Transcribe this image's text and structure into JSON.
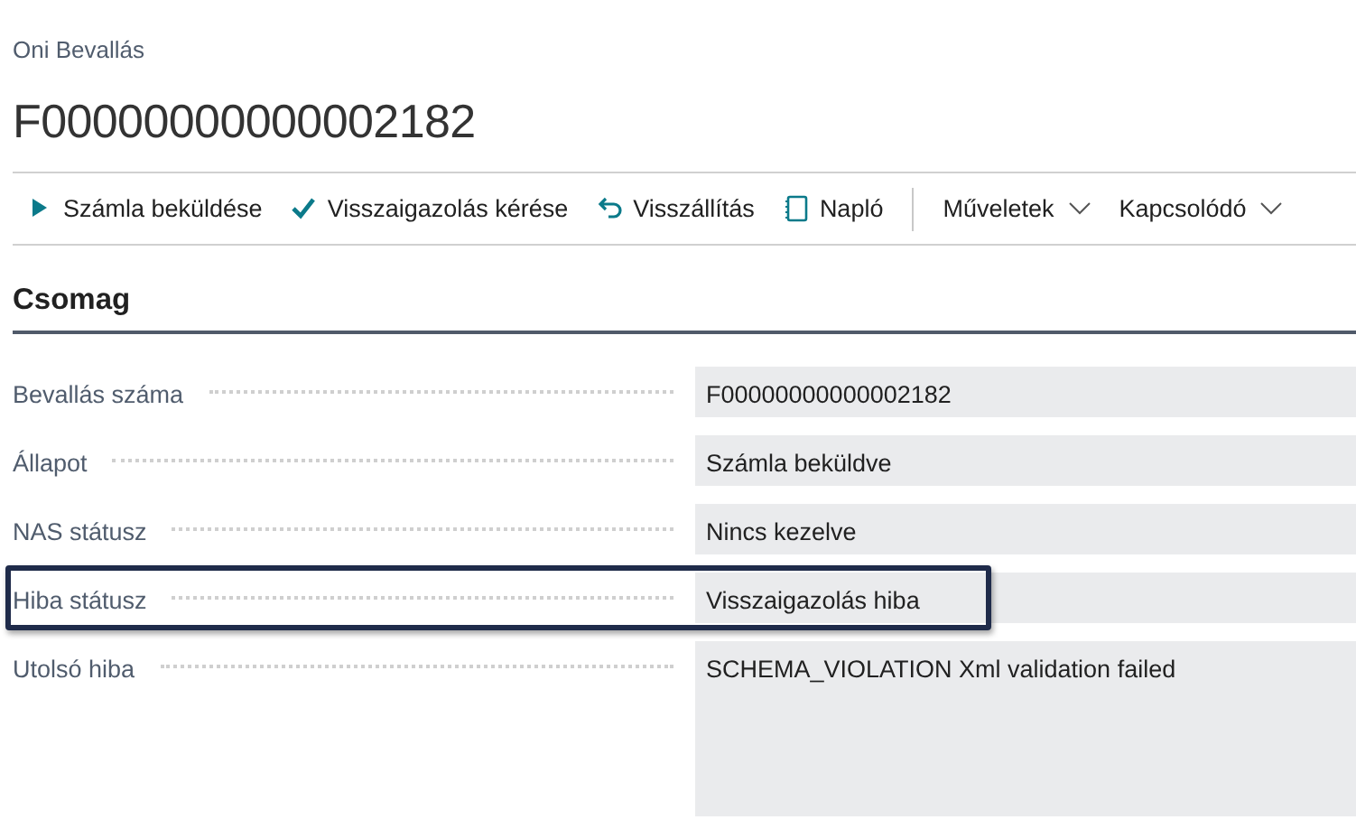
{
  "breadcrumb": "Oni Bevallás",
  "title": "F00000000000002182",
  "actions": [
    {
      "kind": "play",
      "label": "Számla beküldése"
    },
    {
      "kind": "check",
      "label": "Visszaigazolás kérése"
    },
    {
      "kind": "undo",
      "label": "Visszállítás"
    },
    {
      "kind": "log",
      "label": "Napló"
    }
  ],
  "menus": [
    {
      "label": "Műveletek"
    },
    {
      "label": "Kapcsolódó"
    }
  ],
  "section": {
    "title": "Csomag",
    "fields": [
      {
        "label": "Bevallás száma",
        "value": "F00000000000002182",
        "highlighted": false,
        "kind": "line"
      },
      {
        "label": "Állapot",
        "value": "Számla beküldve",
        "highlighted": false,
        "kind": "line"
      },
      {
        "label": "NAS státusz",
        "value": "Nincs kezelve",
        "highlighted": false,
        "kind": "line"
      },
      {
        "label": "Hiba státusz",
        "value": "Visszaigazolás hiba",
        "highlighted": true,
        "kind": "line"
      },
      {
        "label": "Utolsó hiba",
        "value": "SCHEMA_VIOLATION Xml validation failed",
        "highlighted": false,
        "kind": "multiline"
      }
    ]
  }
}
